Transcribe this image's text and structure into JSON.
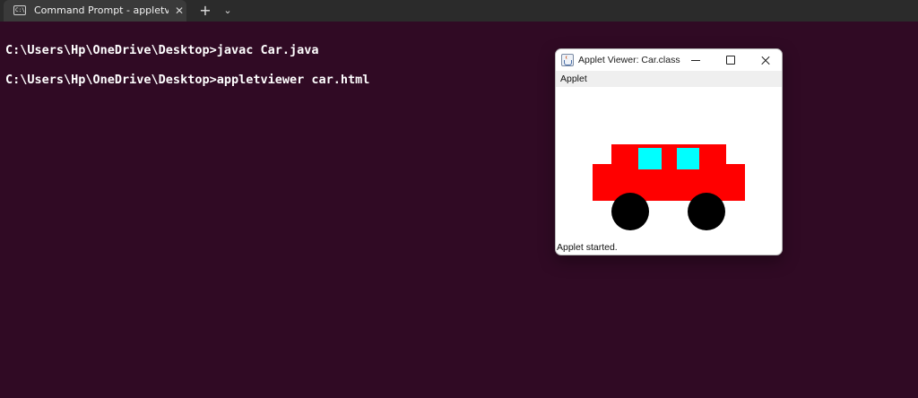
{
  "terminal": {
    "tab_title": "Command Prompt - appletvie",
    "tab_icon_text": "C:\\.",
    "close_glyph": "✕",
    "new_tab_glyph": "+",
    "dropdown_glyph": "⌄",
    "lines": [
      "C:\\Users\\Hp\\OneDrive\\Desktop>javac Car.java",
      "C:\\Users\\Hp\\OneDrive\\Desktop>appletviewer car.html"
    ],
    "background": "#300a24"
  },
  "applet_window": {
    "title": "Applet Viewer: Car.class",
    "menu": [
      "Applet"
    ],
    "status": "Applet started.",
    "icons": [
      "java-icon",
      "minimize-icon",
      "maximize-icon",
      "close-icon"
    ]
  },
  "car": {
    "body_color": "#ff0000",
    "window_color": "#00ffff",
    "wheel_color": "#000000"
  }
}
